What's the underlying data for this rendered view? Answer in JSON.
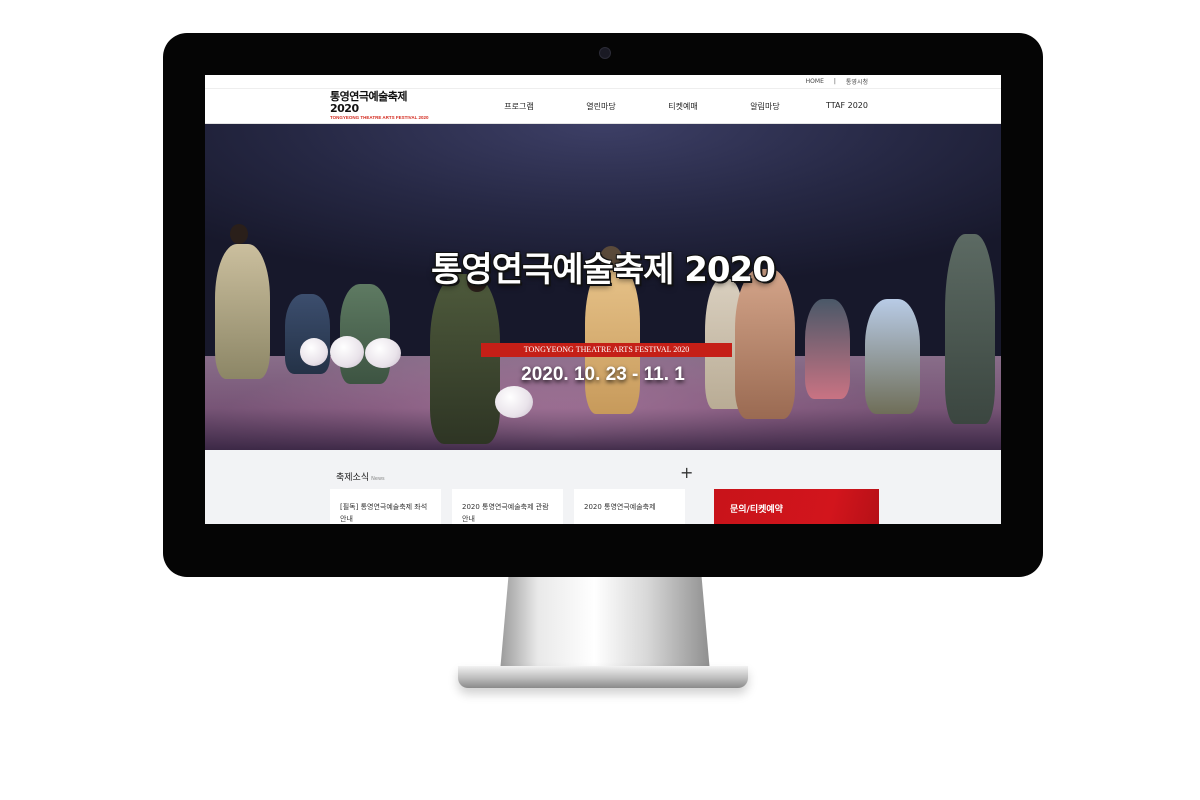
{
  "utility": {
    "home": "HOME",
    "separator": "|",
    "link2": "통영시청"
  },
  "logo": {
    "main": "통영연극예술축제 2020",
    "sub": "TONGYEONG THEATRE ARTS FESTIVAL 2020"
  },
  "nav": {
    "items": [
      {
        "label": "프로그램"
      },
      {
        "label": "열린마당"
      },
      {
        "label": "티켓예매"
      },
      {
        "label": "알림마당"
      },
      {
        "label": "TTAF 2020"
      }
    ]
  },
  "hero": {
    "title": "통영연극예술축제 2020",
    "ribbon": "TONGYEONG THEATRE ARTS FESTIVAL 2020",
    "date": "2020. 10. 23 - 11. 1",
    "slide_count": 4,
    "active_slide": 1
  },
  "news": {
    "heading": "축제소식",
    "heading_sub": "News",
    "plus": "+",
    "cards": [
      {
        "text": "[필독] 통영연극예술축제 좌석안내"
      },
      {
        "text": "2020 통영연극예술축제 관람안내"
      },
      {
        "text": "2020 통영연극예술축제"
      }
    ]
  },
  "contact": {
    "label": "문의/티켓예약"
  },
  "colors": {
    "accent": "#c8131a",
    "bezel": "#050505",
    "news_bg": "#f2f3f5"
  }
}
